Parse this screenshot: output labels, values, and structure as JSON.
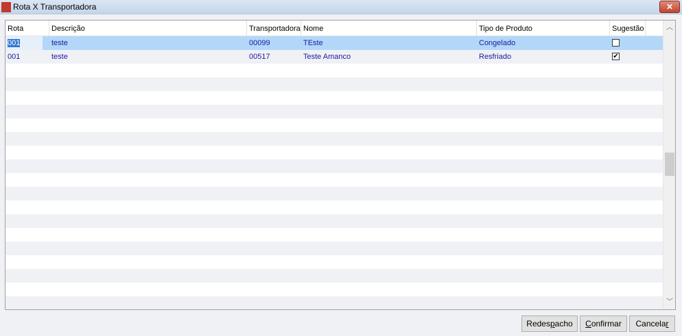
{
  "window": {
    "title": "Rota X Transportadora",
    "app_icon": "11",
    "close": "✕"
  },
  "grid": {
    "columns": [
      "Rota",
      "Descrição",
      "Transportadora",
      "Nome",
      "Tipo de Produto",
      "Sugestão"
    ],
    "rows": [
      {
        "rota": "001",
        "descricao": "teste",
        "transportadora": "00099",
        "nome": "TEste",
        "tipo": "Congelado",
        "sugestao": false,
        "selected": true
      },
      {
        "rota": "001",
        "descricao": "teste",
        "transportadora": "00517",
        "nome": "Teste Amanco",
        "tipo": "Resfriado",
        "sugestao": true,
        "selected": false
      }
    ],
    "empty_rows": 18
  },
  "buttons": {
    "redespacho": {
      "pre": "Redes",
      "key": "p",
      "post": "acho"
    },
    "confirmar": {
      "pre": "",
      "key": "C",
      "post": "onfirmar"
    },
    "cancelar": {
      "pre": "Cancela",
      "key": "r",
      "post": ""
    }
  }
}
